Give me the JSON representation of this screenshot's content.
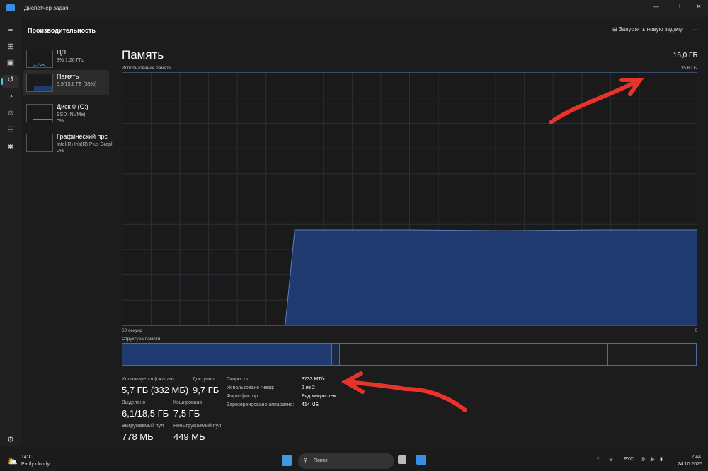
{
  "window": {
    "title": "Диспетчер задач"
  },
  "header": {
    "title": "Производительность",
    "new_task": "Запустить новую задачу",
    "more": "..."
  },
  "sidebar": {
    "items": [
      {
        "name": "ЦП",
        "sub": "3% 1,20 ГГц",
        "sub2": ""
      },
      {
        "name": "Память",
        "sub": "5,9/15,6 ГБ (38%)",
        "sub2": ""
      },
      {
        "name": "Диск 0 (C:)",
        "sub": "SSD (NVMe)",
        "sub2": "0%"
      },
      {
        "name": "Графический прс",
        "sub": "Intel(R) Iris(R) Plus Grapl",
        "sub2": "0%"
      }
    ]
  },
  "main": {
    "title": "Память",
    "total": "16,0 ГБ",
    "usage_label": "Использование памяти",
    "usage_max": "15,6 ГБ",
    "time_left": "60 секунд",
    "time_right": "0",
    "structure_label": "Структура памяти",
    "stats": [
      {
        "label": "Используется (сжатая)",
        "value": "5,7 ГБ (332 МБ)"
      },
      {
        "label": "Доступно",
        "value": "9,7 ГБ"
      },
      {
        "label": "Выделено",
        "value": "6,1/18,5 ГБ"
      },
      {
        "label": "Кэшировано",
        "value": "7,5 ГБ"
      },
      {
        "label": "Выгружаемый пул",
        "value": "778 МБ"
      },
      {
        "label": "Невыгружаемый пул",
        "value": "449 МБ"
      }
    ],
    "props": [
      {
        "label": "Скорость:",
        "value": "3733 MT/c"
      },
      {
        "label": "Использовано гнезд:",
        "value": "2 из 2"
      },
      {
        "label": "Форм-фактор:",
        "value": "Ряд микросхем"
      },
      {
        "label": "Зарезервировано аппаратно:",
        "value": "414 МБ"
      }
    ]
  },
  "chart_data": {
    "type": "area",
    "title": "Использование памяти",
    "xlabel": "",
    "x_range_seconds_ago": [
      60,
      0
    ],
    "ylim": [
      0,
      15.6
    ],
    "y_unit": "ГБ",
    "grid": true,
    "color": "#1e3a6e",
    "line_color": "#5b7fc4",
    "x": [
      60,
      44,
      43,
      42,
      41,
      40,
      30,
      20,
      10,
      0
    ],
    "values": [
      0,
      0,
      0,
      5.9,
      5.9,
      5.9,
      5.9,
      5.85,
      5.9,
      5.9
    ],
    "composition_gb": {
      "in_use": 5.7,
      "modified": 0.2,
      "standby": 7.3,
      "free": 2.4
    }
  },
  "taskbar": {
    "temp": "14°C",
    "weather": "Partly cloudy",
    "search": "Поиск",
    "lang": "РУС",
    "time": "2:44",
    "date": "24.10.2025"
  }
}
